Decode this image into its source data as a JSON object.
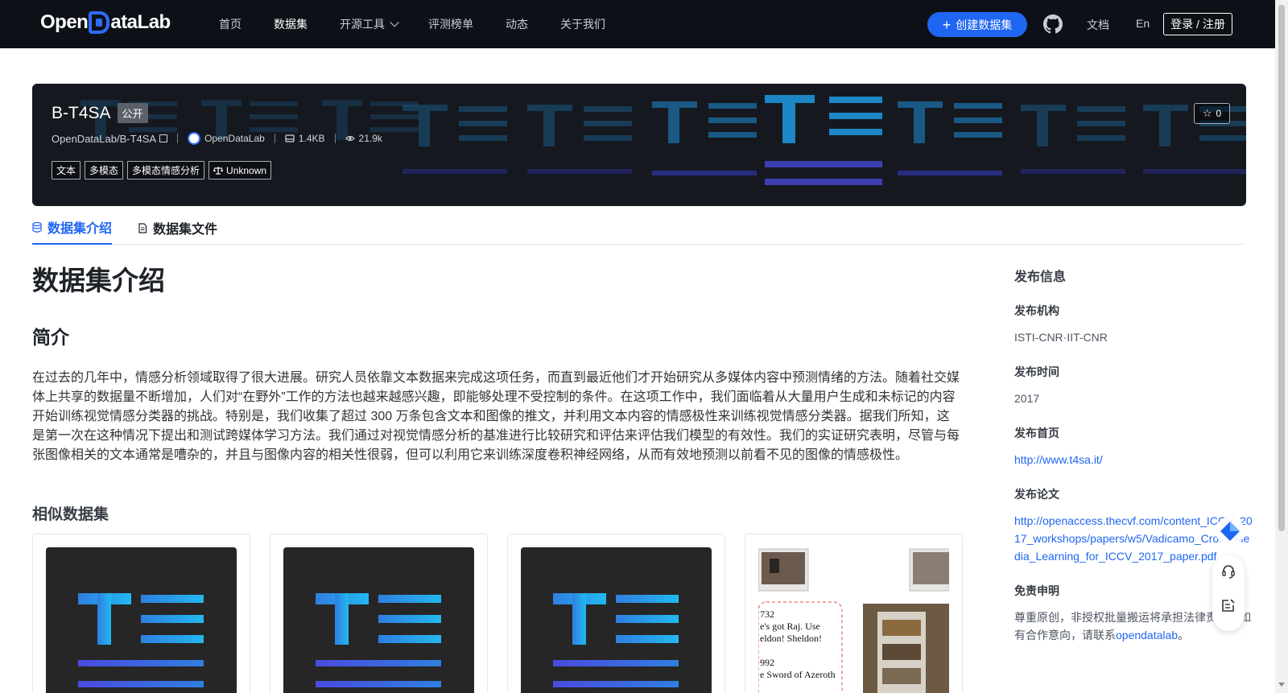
{
  "nav": {
    "logo_text_left": "Open",
    "logo_text_right": "ataLab",
    "links": [
      "首页",
      "数据集",
      "开源工具",
      "评测榜单",
      "动态",
      "关于我们"
    ],
    "create_label": "创建数据集",
    "docs_label": "文档",
    "lang_label": "En",
    "login_label": "登录 / 注册"
  },
  "dataset": {
    "name": "B-T4SA",
    "visibility": "公开",
    "path": "OpenDataLab/B-T4SA",
    "org": "OpenDataLab",
    "size": "1.4KB",
    "views": "21.9k",
    "tags": [
      "文本",
      "多模态",
      "多模态情感分析"
    ],
    "license": "Unknown",
    "stars": "0"
  },
  "tabs": [
    "数据集介绍",
    "数据集文件"
  ],
  "main": {
    "title": "数据集介绍",
    "section_title": "简介",
    "intro": "在过去的几年中，情感分析领域取得了很大进展。研究人员依靠文本数据来完成这项任务，而直到最近他们才开始研究从多媒体内容中预测情绪的方法。随着社交媒体上共享的数据量不断增加，人们对“在野外”工作的方法也越来越感兴趣，即能够处理不受控制的条件。在这项工作中，我们面临着从大量用户生成和未标记的内容开始训练视觉情感分类器的挑战。特别是，我们收集了超过 300 万条包含文本和图像的推文，并利用文本内容的情感极性来训练视觉情感分类器。据我们所知，这是第一次在这种情况下提出和测试跨媒体学习方法。我们通过对视觉情感分析的基准进行比较研究和评估来评估我们模型的有效性。我们的实证研究表明，尽管与每张图像相关的文本通常是嘈杂的，并且与图像内容的相关性很弱，但可以利用它来训练深度卷积神经网络，从而有效地预测以前看不见的图像的情感极性。",
    "similar_title": "相似数据集",
    "photo_card_text": [
      "732",
      "e's got Raj. Use",
      "eldon! Sheldon!",
      "992",
      "e Sword of Azeroth"
    ]
  },
  "sidebar": {
    "title": "发布信息",
    "org_label": "发布机构",
    "org_value": "ISTI-CNR·IIT-CNR",
    "time_label": "发布时间",
    "time_value": "2017",
    "home_label": "发布首页",
    "home_value": "http://www.t4sa.it/",
    "paper_label": "发布论文",
    "paper_value": "http://openaccess.thecvf.com/content_ICCV_2017_workshops/papers/w5/Vadicamo_Cross-Media_Learning_for_ICCV_2017_paper.pdf",
    "disclaimer_label": "免责申明",
    "disclaimer_text": "尊重原创，非授权批量搬运将承担法律责任。如有合作意向，请联系",
    "disclaimer_link": "opendatalab",
    "disclaimer_end": "。"
  },
  "colors": {
    "nav_bg": "#0d1117",
    "accent": "#1f66f2",
    "banner_bg": "#15181f"
  }
}
